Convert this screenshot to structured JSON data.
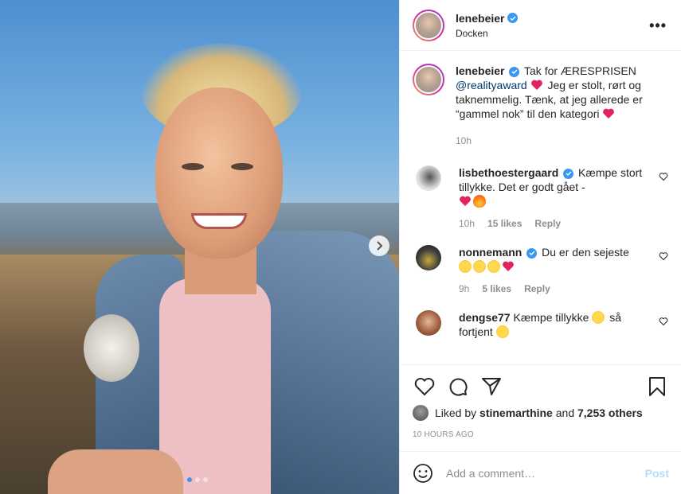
{
  "post": {
    "author": "lenebeier",
    "location": "Docken",
    "more_label": "•••",
    "caption": {
      "username": "lenebeier",
      "text_before_mention": "Tak for ÆRESPRISEN",
      "mention": "@realityaward",
      "text_after": "Jeg er stolt, rørt og taknemmelig. Tænk, at jeg allerede er “gammel nok” til den kategori",
      "time": "10h"
    },
    "comments": [
      {
        "username": "lisbethoestergaard",
        "verified": true,
        "text": "Kæmpe stort tillykke. Det er godt gået -",
        "emojis": [
          "red-heart",
          "fire"
        ],
        "time": "10h",
        "likes": "15 likes",
        "reply": "Reply"
      },
      {
        "username": "nonnemann",
        "verified": true,
        "text": "Du er den sejeste",
        "emojis": [
          "star-struck",
          "star-struck",
          "star-struck",
          "red-heart"
        ],
        "time": "9h",
        "likes": "5 likes",
        "reply": "Reply"
      },
      {
        "username": "dengse77",
        "verified": false,
        "text": "Kæmpe tillykke",
        "text2": "så fortjent",
        "emojis": [
          "star-struck",
          "star-struck"
        ]
      }
    ],
    "liked_by": {
      "prefix": "Liked by",
      "user": "stinemarthine",
      "middle": "and",
      "count": "7,253 others"
    },
    "timestamp": "10 HOURS AGO",
    "comment_input": {
      "placeholder": "Add a comment…"
    },
    "post_button": "Post",
    "carousel": {
      "slides": 3,
      "active": 1
    }
  },
  "colors": {
    "verified": "#3897f0",
    "mention": "#00376b",
    "muted": "#8e8e8e",
    "post_disabled": "#b2dffc",
    "heart": "#ed4956"
  }
}
